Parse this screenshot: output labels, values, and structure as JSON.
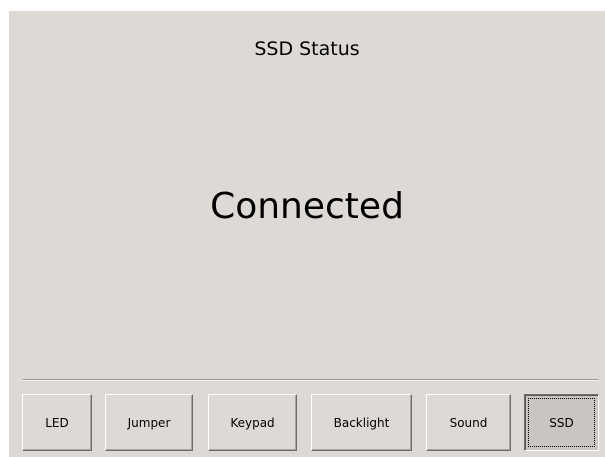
{
  "screen": {
    "title": "SSD Status",
    "status": "Connected"
  },
  "tabs": [
    {
      "label": "LED",
      "active": false
    },
    {
      "label": "Jumper",
      "active": false
    },
    {
      "label": "Keypad",
      "active": false
    },
    {
      "label": "Backlight",
      "active": false
    },
    {
      "label": "Sound",
      "active": false
    },
    {
      "label": "SSD",
      "active": true
    }
  ],
  "colors": {
    "background": "#dddad5",
    "active_button": "#c9c6c1"
  }
}
